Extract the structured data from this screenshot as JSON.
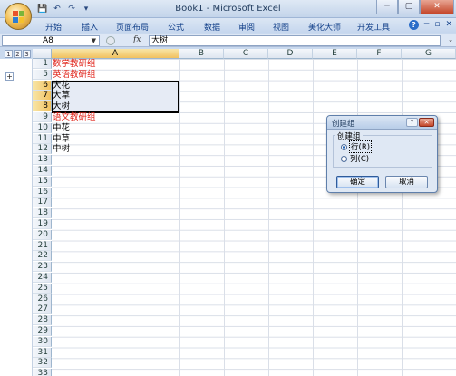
{
  "window": {
    "title": "Book1 - Microsoft Excel",
    "controls": {
      "minimize": "─",
      "restore": "▢",
      "close": "✕"
    }
  },
  "quick_access": {
    "save": "💾",
    "undo": "↶",
    "redo": "↷",
    "customize": "▾"
  },
  "ribbon": {
    "tabs": [
      "开始",
      "插入",
      "页面布局",
      "公式",
      "数据",
      "审阅",
      "视图",
      "美化大师",
      "开发工具"
    ],
    "help": "?",
    "minimize": "─",
    "restore": "▫",
    "close": "✕"
  },
  "formula_bar": {
    "name_box": "A8",
    "fx": "fx",
    "value": "大树"
  },
  "outline": {
    "levels": [
      "1",
      "2",
      "3"
    ],
    "expand": "+"
  },
  "grid": {
    "columns": [
      "A",
      "B",
      "C",
      "D",
      "E",
      "F",
      "G"
    ],
    "active_column": "A",
    "rows": [
      {
        "num": "1",
        "value": "数学教研组",
        "color": "red"
      },
      {
        "num": "5",
        "value": "英语教研组",
        "color": "red"
      },
      {
        "num": "6",
        "value": "大花",
        "color": "black"
      },
      {
        "num": "7",
        "value": "大草",
        "color": "black"
      },
      {
        "num": "8",
        "value": "大树",
        "color": "black"
      },
      {
        "num": "9",
        "value": "语文教研组",
        "color": "red"
      },
      {
        "num": "10",
        "value": "中花",
        "color": "black"
      },
      {
        "num": "11",
        "value": "中草",
        "color": "black"
      },
      {
        "num": "12",
        "value": "中树",
        "color": "black"
      },
      {
        "num": "13",
        "value": ""
      },
      {
        "num": "14",
        "value": ""
      },
      {
        "num": "15",
        "value": ""
      },
      {
        "num": "16",
        "value": ""
      },
      {
        "num": "17",
        "value": ""
      },
      {
        "num": "18",
        "value": ""
      },
      {
        "num": "19",
        "value": ""
      },
      {
        "num": "20",
        "value": ""
      },
      {
        "num": "21",
        "value": ""
      },
      {
        "num": "22",
        "value": ""
      },
      {
        "num": "23",
        "value": ""
      },
      {
        "num": "24",
        "value": ""
      },
      {
        "num": "25",
        "value": ""
      },
      {
        "num": "26",
        "value": ""
      },
      {
        "num": "27",
        "value": ""
      },
      {
        "num": "28",
        "value": ""
      },
      {
        "num": "29",
        "value": ""
      },
      {
        "num": "30",
        "value": ""
      },
      {
        "num": "31",
        "value": ""
      },
      {
        "num": "32",
        "value": ""
      },
      {
        "num": "33",
        "value": ""
      }
    ],
    "selected_rows": [
      "6",
      "7",
      "8"
    ],
    "colors": {
      "red": "#e0241a",
      "black": "#000000"
    }
  },
  "dialog": {
    "title": "创建组",
    "help": "?",
    "close": "✕",
    "group_label": "创建组",
    "options": [
      {
        "label": "行(R)",
        "selected": true
      },
      {
        "label": "列(C)",
        "selected": false
      }
    ],
    "ok": "确定",
    "cancel": "取消"
  }
}
